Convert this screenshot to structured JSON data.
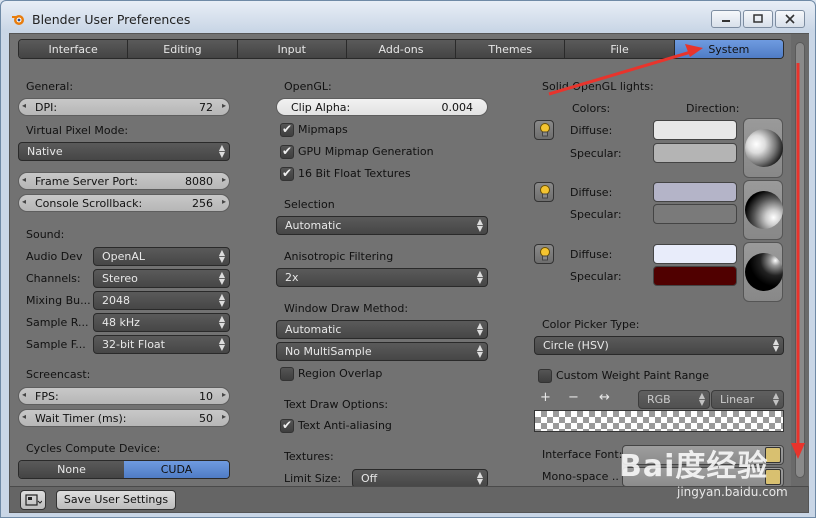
{
  "window": {
    "title": "Blender User Preferences"
  },
  "tabs": [
    "Interface",
    "Editing",
    "Input",
    "Add-ons",
    "Themes",
    "File",
    "System"
  ],
  "active_tab": "System",
  "left": {
    "general_label": "General:",
    "dpi": {
      "label": "DPI:",
      "value": "72"
    },
    "virtual_pixel_label": "Virtual Pixel Mode:",
    "virtual_pixel_value": "Native",
    "frame_server": {
      "label": "Frame Server Port:",
      "value": "8080"
    },
    "console_scrollback": {
      "label": "Console Scrollback:",
      "value": "256"
    },
    "sound_label": "Sound:",
    "sound_rows": [
      {
        "label": "Audio Dev",
        "value": "OpenAL"
      },
      {
        "label": "Channels:",
        "value": "Stereo"
      },
      {
        "label": "Mixing Bu...",
        "value": "2048"
      },
      {
        "label": "Sample R...",
        "value": "48 kHz"
      },
      {
        "label": "Sample F...",
        "value": "32-bit Float"
      }
    ],
    "screencast_label": "Screencast:",
    "fps": {
      "label": "FPS:",
      "value": "10"
    },
    "wait_timer": {
      "label": "Wait Timer (ms):",
      "value": "50"
    },
    "cycles_label": "Cycles Compute Device:",
    "cycles_options": [
      "None",
      "CUDA"
    ],
    "cycles_selected": "CUDA"
  },
  "middle": {
    "opengl_label": "OpenGL:",
    "clip_alpha": {
      "label": "Clip Alpha:",
      "value": "0.004"
    },
    "mipmaps": "Mipmaps",
    "gpu_mipmap": "GPU Mipmap Generation",
    "float_textures": "16 Bit Float Textures",
    "selection_label": "Selection",
    "selection_value": "Automatic",
    "anisotropic_label": "Anisotropic Filtering",
    "anisotropic_value": "2x",
    "window_draw_label": "Window Draw Method:",
    "window_draw_value": "Automatic",
    "multisample_value": "No MultiSample",
    "region_overlap": "Region Overlap",
    "text_draw_label": "Text Draw Options:",
    "text_antialias": "Text Anti-aliasing",
    "textures_label": "Textures:",
    "limit_size_label": "Limit Size:",
    "limit_size_value": "Off"
  },
  "right": {
    "solid_lights_label": "Solid OpenGL lights:",
    "colors_label": "Colors:",
    "direction_label": "Direction:",
    "diffuse_label": "Diffuse:",
    "specular_label": "Specular:",
    "lights": [
      {
        "diffuse": "#e8e8e8",
        "specular": "#b4b4b4"
      },
      {
        "diffuse": "#b4b4c8",
        "specular": "#7a7a7a"
      },
      {
        "diffuse": "#e8ecfa",
        "specular": "#500000"
      }
    ],
    "color_picker_label": "Color Picker Type:",
    "color_picker_value": "Circle (HSV)",
    "custom_weight": "Custom Weight Paint Range",
    "ramp_mode": "RGB",
    "ramp_interp": "Linear",
    "interface_font_label": "Interface Font:",
    "monospace_label": "Mono-space ..."
  },
  "footer": {
    "save_label": "Save User Settings"
  },
  "watermark": {
    "brand": "Bai度经验",
    "url": "jingyan.baidu.com"
  },
  "colors": {
    "active_tab": "#5b88d4",
    "arrow": "#e8342c"
  }
}
